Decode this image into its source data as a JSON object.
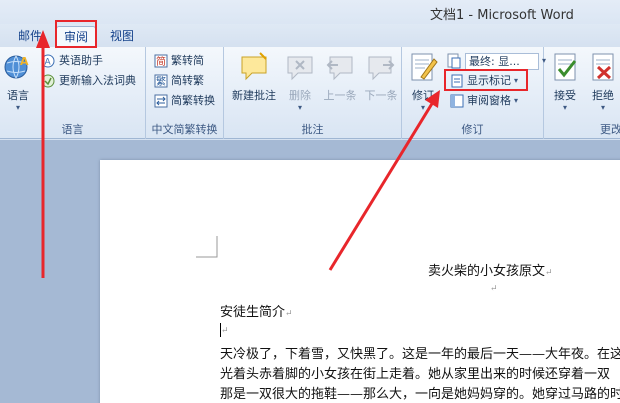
{
  "window": {
    "title": "文档1 - Microsoft Word"
  },
  "tabs": [
    {
      "label": "邮件",
      "active": false
    },
    {
      "label": "审阅",
      "active": true
    },
    {
      "label": "视图",
      "active": false
    }
  ],
  "ribbon": {
    "language": {
      "label": "语言",
      "language_button": "语言",
      "english_assistant": "英语助手",
      "update_ime": "更新输入法词典"
    },
    "chinese_conversion": {
      "label": "中文简繁转换",
      "to_simplified": "繁转简",
      "to_traditional": "简转繁",
      "conversion": "简繁转换"
    },
    "comments": {
      "label": "批注",
      "new_comment": "新建批注",
      "delete": "删除",
      "previous": "上一条",
      "next": "下一条"
    },
    "tracking": {
      "label": "修订",
      "track_changes": "修订",
      "final_display": "最终: 显...",
      "show_markup": "显示标记",
      "reviewing_pane": "审阅窗格"
    },
    "changes": {
      "label": "更改",
      "accept": "接受",
      "reject": "拒绝"
    }
  },
  "document": {
    "title": "卖火柴的小女孩原文",
    "heading": "安徒生简介",
    "para_line1": "天冷极了，下着雪，又快黑了。这是一年的最后一天——大年夜。在这",
    "para_line2": "光着头赤着脚的小女孩在街上走着。她从家里出来的时候还穿着一双",
    "para_line3": "那是一双很大的拖鞋——那么大，一向是她妈妈穿的。她穿过马路的时"
  },
  "colors": {
    "annotation": "#e8262b",
    "accent": "#15428b"
  }
}
